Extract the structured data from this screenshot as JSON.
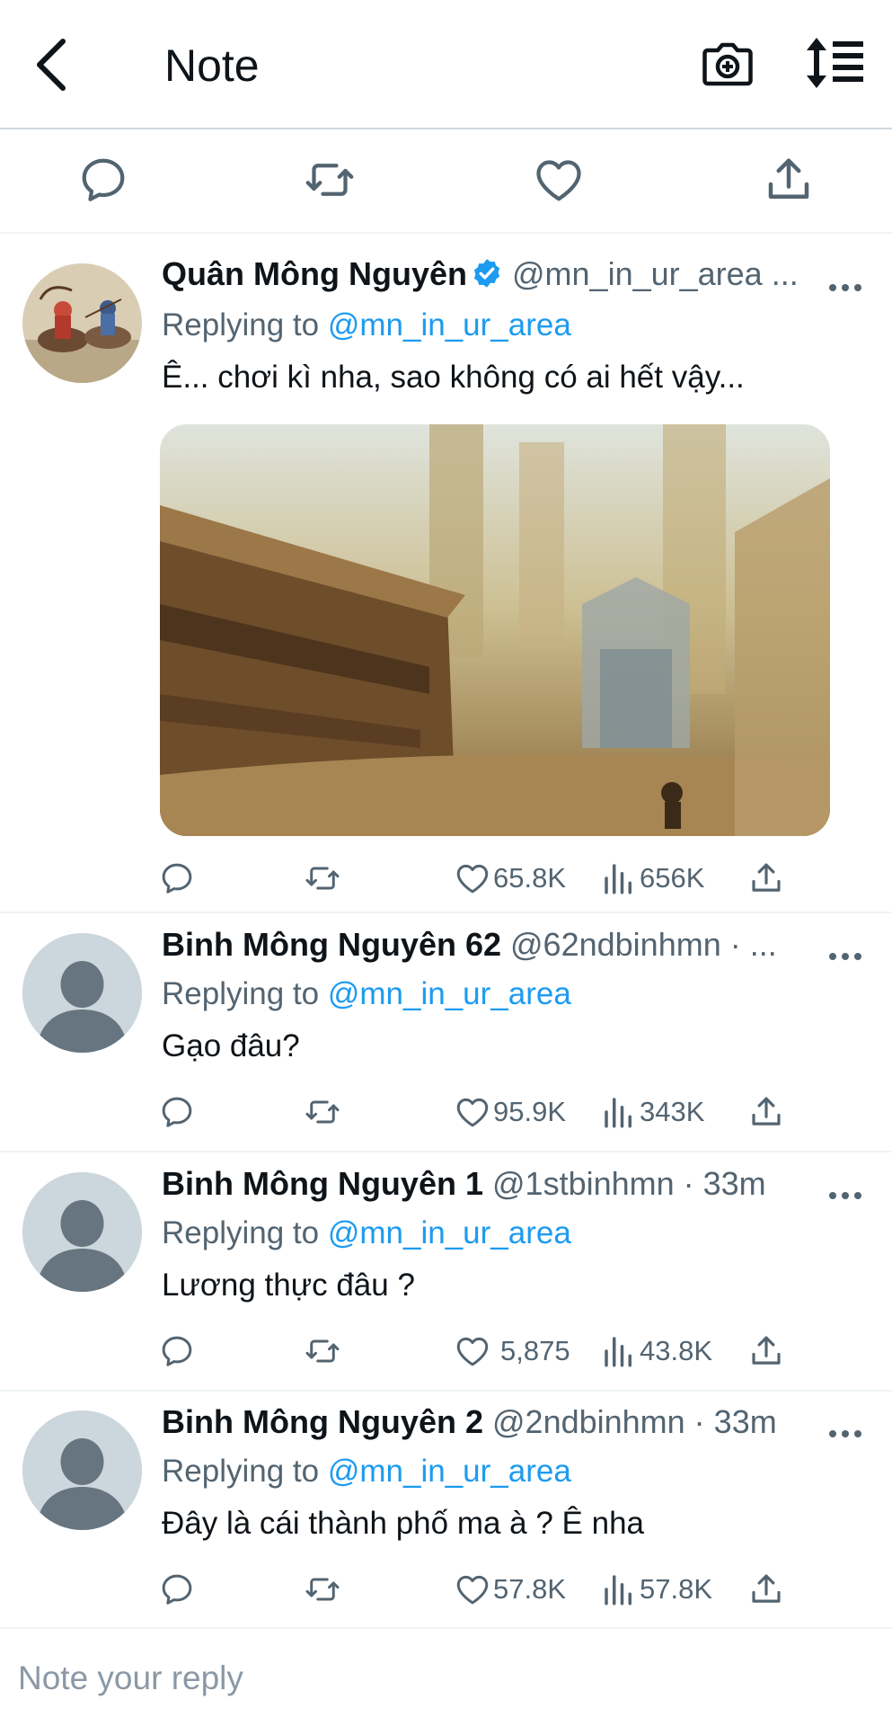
{
  "header": {
    "title": "Note",
    "icons": [
      "back-arrow-icon",
      "camera-add-icon",
      "sort-list-icon"
    ]
  },
  "top_actions": [
    "reply-icon",
    "retweet-icon",
    "like-icon",
    "share-icon"
  ],
  "colors": {
    "accent": "#1d9bf0",
    "muted": "#536471",
    "divider": "#eff3f4"
  },
  "posts": [
    {
      "name": "Quân Mông Nguyên",
      "verified": true,
      "meta": "@mn_in_ur_area ...",
      "replying_prefix": "Replying to",
      "replying_to": "@mn_in_ur_area",
      "text": "Ê... chơi kì nha, sao không có ai hết vậy...",
      "has_media": true,
      "likes": "65.8K",
      "views": "656K"
    },
    {
      "name": "Binh Mông Nguyên 62",
      "verified": false,
      "meta": "@62ndbinhmn · ...",
      "replying_prefix": "Replying to",
      "replying_to": "@mn_in_ur_area",
      "text": "Gạo đâu?",
      "has_media": false,
      "likes": "95.9K",
      "views": "343K"
    },
    {
      "name": "Binh Mông Nguyên 1",
      "verified": false,
      "meta": "@1stbinhmn · 33m",
      "replying_prefix": "Replying to",
      "replying_to": "@mn_in_ur_area",
      "text": "Lương thực đâu ?",
      "has_media": false,
      "likes": "5,875",
      "views": "43.8K"
    },
    {
      "name": "Binh Mông Nguyên 2",
      "verified": false,
      "meta": "@2ndbinhmn · 33m",
      "replying_prefix": "Replying to",
      "replying_to": "@mn_in_ur_area",
      "text": "Đây là cái thành phố ma à ? Ê nha",
      "has_media": false,
      "likes": "57.8K",
      "views": "57.8K"
    }
  ],
  "compose": {
    "placeholder": "Note your reply"
  }
}
